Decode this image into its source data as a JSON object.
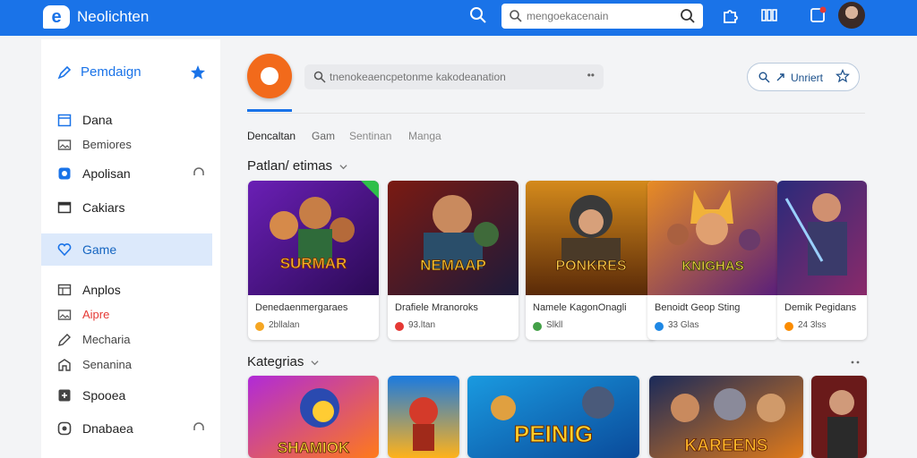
{
  "header": {
    "brand": "Neolichten",
    "search_placeholder": "mengoekacenain"
  },
  "sidebar": {
    "header": "Pemdaign",
    "items": [
      {
        "label": "Dana",
        "icon": "calendar-icon"
      },
      {
        "label": "Bemiores",
        "icon": "image-icon"
      },
      {
        "label": "Apolisan",
        "icon": "shield-icon"
      },
      {
        "label": "Cakiars",
        "icon": "window-icon"
      },
      {
        "label": "Game",
        "icon": "heart-icon"
      },
      {
        "label": "Anplos",
        "icon": "grid-icon"
      },
      {
        "label": "Aipre",
        "icon": "image-icon"
      },
      {
        "label": "Mecharia",
        "icon": "pen-icon"
      },
      {
        "label": "Senanina",
        "icon": "home-icon"
      },
      {
        "label": "Spooea",
        "icon": "puzzle-icon"
      },
      {
        "label": "Dnabaea",
        "icon": "circle-icon"
      }
    ]
  },
  "main": {
    "search_placeholder": "tnenokeaencpetonme kakodeanation",
    "search_dots": "••",
    "pill_label": "Unriert",
    "tabs": [
      "Dencaltan",
      "Gam",
      "Sentinan",
      "Manga"
    ],
    "section_popular": "Patlan/ etimas",
    "section_categories": "Kategrias",
    "cards": [
      {
        "title": "Denedaenmergaraes",
        "meta": "2bllalan",
        "thumb_text": "SURMAR",
        "dot_color": "#f5a623"
      },
      {
        "title": "Drafiele Mranoroks",
        "meta": "93.ltan",
        "thumb_text": "NEMAAP",
        "dot_color": "#e53935"
      },
      {
        "title": "Namele KagonOnagli",
        "meta": "Slkll",
        "thumb_text": "PONKRES",
        "dot_color": "#43a047"
      },
      {
        "title": "Benoidt Geop Sting",
        "meta": "33 Glas",
        "thumb_text": "KNIGHAS",
        "dot_color": "#1e88e5"
      },
      {
        "title": "Demik Pegidans",
        "meta": "24 3lss",
        "thumb_text": "",
        "dot_color": "#fb8c00"
      }
    ],
    "categories": [
      {
        "thumb_text": "SHAMIOK"
      },
      {
        "thumb_text": ""
      },
      {
        "thumb_text": "PEINIG"
      },
      {
        "thumb_text": "KAREENS"
      },
      {
        "thumb_text": ""
      }
    ]
  },
  "colors": {
    "accent": "#1a73e8",
    "logo_orange": "#f26a1b",
    "active_bg": "#dce9fb"
  }
}
